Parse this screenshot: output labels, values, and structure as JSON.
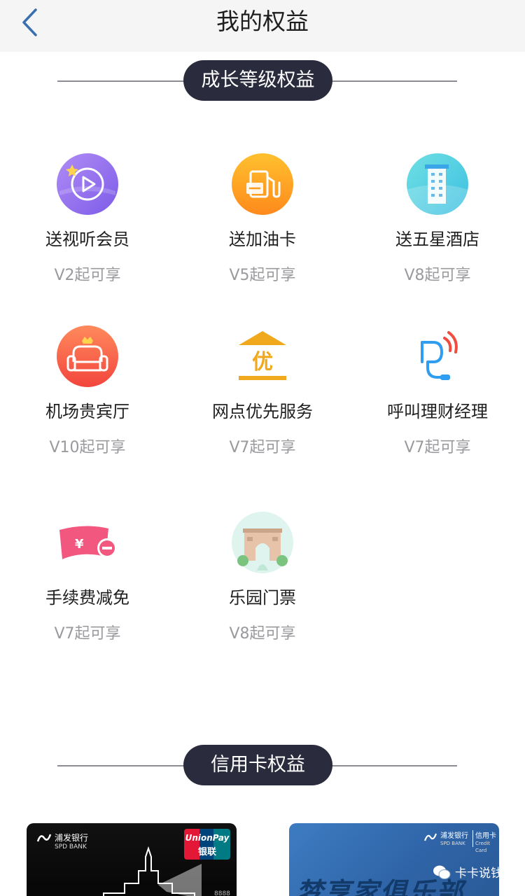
{
  "nav": {
    "title": "我的权益"
  },
  "sections": {
    "growth_title": "成长等级权益",
    "credit_title": "信用卡权益"
  },
  "benefits": [
    {
      "name": "送视听会员",
      "level": "V2起可享",
      "icon": "video-play-icon"
    },
    {
      "name": "送加油卡",
      "level": "V5起可享",
      "icon": "gas-pump-icon"
    },
    {
      "name": "送五星酒店",
      "level": "V8起可享",
      "icon": "hotel-building-icon"
    },
    {
      "name": "机场贵宾厅",
      "level": "V10起可享",
      "icon": "lounge-sofa-icon"
    },
    {
      "name": "网点优先服务",
      "level": "V7起可享",
      "icon": "priority-branch-icon"
    },
    {
      "name": "呼叫理财经理",
      "level": "V7起可享",
      "icon": "headset-icon"
    },
    {
      "name": "手续费减免",
      "level": "V7起可享",
      "icon": "fee-waiver-icon"
    },
    {
      "name": "乐园门票",
      "level": "V8起可享",
      "icon": "park-gate-icon"
    }
  ],
  "cards": {
    "black": {
      "bank_cn": "浦发银行",
      "bank_en": "SPD BANK",
      "network_en": "UnionPay",
      "network_cn": "银联",
      "number_fragment": "8888"
    },
    "blue": {
      "bank_cn": "浦发银行",
      "bank_en": "SPD BANK",
      "card_type_cn": "信用卡",
      "card_type_en": "Credit Card",
      "club_text": "梦享家俱乐部"
    }
  },
  "watermark": {
    "text": "卡卡说钱"
  },
  "colors": {
    "pill_bg": "#2a2b3c",
    "back_arrow": "#3a6fb0",
    "level_text": "#9a9a9e"
  }
}
